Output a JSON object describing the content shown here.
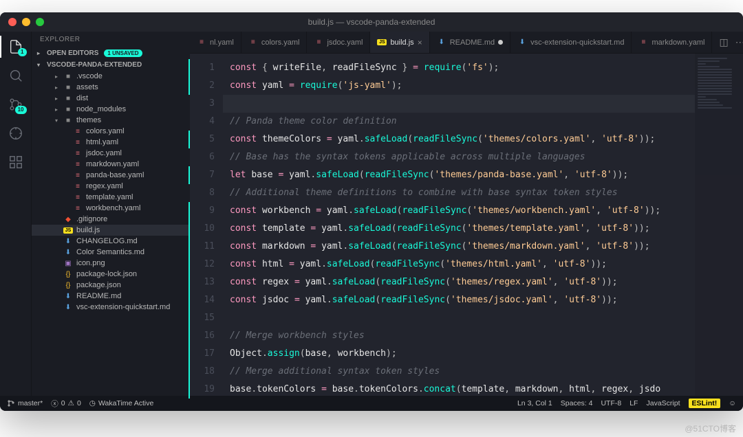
{
  "window": {
    "title": "build.js — vscode-panda-extended"
  },
  "activity": {
    "explorer_badge": "1",
    "scm_badge": "10"
  },
  "sidebar": {
    "title": "EXPLORER",
    "open_editors": {
      "label": "OPEN EDITORS",
      "unsaved": "1 UNSAVED"
    },
    "project": {
      "label": "VSCODE-PANDA-EXTENDED"
    },
    "tree": [
      {
        "depth": 1,
        "chev": "▸",
        "icon": "folder",
        "label": ".vscode"
      },
      {
        "depth": 1,
        "chev": "▸",
        "icon": "folder",
        "label": "assets"
      },
      {
        "depth": 1,
        "chev": "▸",
        "icon": "folder",
        "label": "dist"
      },
      {
        "depth": 1,
        "chev": "▸",
        "icon": "folder",
        "label": "node_modules"
      },
      {
        "depth": 1,
        "chev": "▾",
        "icon": "folder",
        "label": "themes"
      },
      {
        "depth": 2,
        "icon": "yaml",
        "label": "colors.yaml"
      },
      {
        "depth": 2,
        "icon": "yaml",
        "label": "html.yaml"
      },
      {
        "depth": 2,
        "icon": "yaml",
        "label": "jsdoc.yaml"
      },
      {
        "depth": 2,
        "icon": "yaml",
        "label": "markdown.yaml"
      },
      {
        "depth": 2,
        "icon": "yaml",
        "label": "panda-base.yaml"
      },
      {
        "depth": 2,
        "icon": "yaml",
        "label": "regex.yaml"
      },
      {
        "depth": 2,
        "icon": "yaml",
        "label": "template.yaml"
      },
      {
        "depth": 2,
        "icon": "yaml",
        "label": "workbench.yaml"
      },
      {
        "depth": 1,
        "icon": "git",
        "label": ".gitignore"
      },
      {
        "depth": 1,
        "icon": "js",
        "label": "build.js",
        "sel": true
      },
      {
        "depth": 1,
        "icon": "md",
        "label": "CHANGELOG.md"
      },
      {
        "depth": 1,
        "icon": "md",
        "label": "Color Semantics.md"
      },
      {
        "depth": 1,
        "icon": "img",
        "label": "icon.png"
      },
      {
        "depth": 1,
        "icon": "json",
        "label": "package-lock.json"
      },
      {
        "depth": 1,
        "icon": "json",
        "label": "package.json"
      },
      {
        "depth": 1,
        "icon": "md",
        "label": "README.md"
      },
      {
        "depth": 1,
        "icon": "md",
        "label": "vsc-extension-quickstart.md"
      }
    ]
  },
  "tabs": [
    {
      "icon": "yaml",
      "label": "nl.yaml"
    },
    {
      "icon": "yaml",
      "label": "colors.yaml"
    },
    {
      "icon": "yaml",
      "label": "jsdoc.yaml"
    },
    {
      "icon": "js",
      "label": "build.js",
      "active": true,
      "dirty": true
    },
    {
      "icon": "md",
      "label": "README.md",
      "dirty": true
    },
    {
      "icon": "md",
      "label": "vsc-extension-quickstart.md"
    },
    {
      "icon": "yaml",
      "label": "markdown.yaml"
    }
  ],
  "code": {
    "lines": [
      {
        "n": 1,
        "mod": true,
        "seg": [
          [
            "kw",
            "const"
          ],
          [
            "pn",
            " { "
          ],
          [
            "id",
            "writeFile"
          ],
          [
            "pn",
            ", "
          ],
          [
            "id",
            "readFileSync"
          ],
          [
            "pn",
            " } "
          ],
          [
            "op",
            "="
          ],
          [
            "pn",
            " "
          ],
          [
            "fn",
            "require"
          ],
          [
            "pn",
            "("
          ],
          [
            "str",
            "'fs'"
          ],
          [
            "pn",
            ");"
          ]
        ]
      },
      {
        "n": 2,
        "mod": true,
        "seg": [
          [
            "kw",
            "const"
          ],
          [
            "pn",
            " "
          ],
          [
            "id",
            "yaml"
          ],
          [
            "pn",
            " "
          ],
          [
            "op",
            "="
          ],
          [
            "pn",
            " "
          ],
          [
            "fn",
            "require"
          ],
          [
            "pn",
            "("
          ],
          [
            "str",
            "'js-yaml'"
          ],
          [
            "pn",
            ");"
          ]
        ]
      },
      {
        "n": 3,
        "mod": false,
        "cur": true,
        "seg": []
      },
      {
        "n": 4,
        "mod": false,
        "seg": [
          [
            "cm",
            "// Panda theme color definition"
          ]
        ]
      },
      {
        "n": 5,
        "mod": true,
        "seg": [
          [
            "kw",
            "const"
          ],
          [
            "pn",
            " "
          ],
          [
            "id",
            "themeColors"
          ],
          [
            "pn",
            " "
          ],
          [
            "op",
            "="
          ],
          [
            "pn",
            " "
          ],
          [
            "id",
            "yaml"
          ],
          [
            "pn",
            "."
          ],
          [
            "fn",
            "safeLoad"
          ],
          [
            "pn",
            "("
          ],
          [
            "fn",
            "readFileSync"
          ],
          [
            "pn",
            "("
          ],
          [
            "str",
            "'themes/colors.yaml'"
          ],
          [
            "pn",
            ", "
          ],
          [
            "str",
            "'utf-8'"
          ],
          [
            "pn",
            "));"
          ]
        ]
      },
      {
        "n": 6,
        "mod": false,
        "seg": [
          [
            "cm",
            "// Base has the syntax tokens applicable across multiple languages"
          ]
        ]
      },
      {
        "n": 7,
        "mod": true,
        "seg": [
          [
            "kw",
            "let"
          ],
          [
            "pn",
            " "
          ],
          [
            "id",
            "base"
          ],
          [
            "pn",
            " "
          ],
          [
            "op",
            "="
          ],
          [
            "pn",
            " "
          ],
          [
            "id",
            "yaml"
          ],
          [
            "pn",
            "."
          ],
          [
            "fn",
            "safeLoad"
          ],
          [
            "pn",
            "("
          ],
          [
            "fn",
            "readFileSync"
          ],
          [
            "pn",
            "("
          ],
          [
            "str",
            "'themes/panda-base.yaml'"
          ],
          [
            "pn",
            ", "
          ],
          [
            "str",
            "'utf-8'"
          ],
          [
            "pn",
            "));"
          ]
        ]
      },
      {
        "n": 8,
        "mod": false,
        "seg": [
          [
            "cm",
            "// Additional theme definitions to combine with base syntax token styles"
          ]
        ]
      },
      {
        "n": 9,
        "mod": true,
        "seg": [
          [
            "kw",
            "const"
          ],
          [
            "pn",
            " "
          ],
          [
            "id",
            "workbench"
          ],
          [
            "pn",
            " "
          ],
          [
            "op",
            "="
          ],
          [
            "pn",
            " "
          ],
          [
            "id",
            "yaml"
          ],
          [
            "pn",
            "."
          ],
          [
            "fn",
            "safeLoad"
          ],
          [
            "pn",
            "("
          ],
          [
            "fn",
            "readFileSync"
          ],
          [
            "pn",
            "("
          ],
          [
            "str",
            "'themes/workbench.yaml'"
          ],
          [
            "pn",
            ", "
          ],
          [
            "str",
            "'utf-8'"
          ],
          [
            "pn",
            "));"
          ]
        ]
      },
      {
        "n": 10,
        "mod": true,
        "seg": [
          [
            "kw",
            "const"
          ],
          [
            "pn",
            " "
          ],
          [
            "id",
            "template"
          ],
          [
            "pn",
            " "
          ],
          [
            "op",
            "="
          ],
          [
            "pn",
            " "
          ],
          [
            "id",
            "yaml"
          ],
          [
            "pn",
            "."
          ],
          [
            "fn",
            "safeLoad"
          ],
          [
            "pn",
            "("
          ],
          [
            "fn",
            "readFileSync"
          ],
          [
            "pn",
            "("
          ],
          [
            "str",
            "'themes/template.yaml'"
          ],
          [
            "pn",
            ", "
          ],
          [
            "str",
            "'utf-8'"
          ],
          [
            "pn",
            "));"
          ]
        ]
      },
      {
        "n": 11,
        "mod": true,
        "seg": [
          [
            "kw",
            "const"
          ],
          [
            "pn",
            " "
          ],
          [
            "id",
            "markdown"
          ],
          [
            "pn",
            " "
          ],
          [
            "op",
            "="
          ],
          [
            "pn",
            " "
          ],
          [
            "id",
            "yaml"
          ],
          [
            "pn",
            "."
          ],
          [
            "fn",
            "safeLoad"
          ],
          [
            "pn",
            "("
          ],
          [
            "fn",
            "readFileSync"
          ],
          [
            "pn",
            "("
          ],
          [
            "str",
            "'themes/markdown.yaml'"
          ],
          [
            "pn",
            ", "
          ],
          [
            "str",
            "'utf-8'"
          ],
          [
            "pn",
            "));"
          ]
        ]
      },
      {
        "n": 12,
        "mod": true,
        "seg": [
          [
            "kw",
            "const"
          ],
          [
            "pn",
            " "
          ],
          [
            "id",
            "html"
          ],
          [
            "pn",
            " "
          ],
          [
            "op",
            "="
          ],
          [
            "pn",
            " "
          ],
          [
            "id",
            "yaml"
          ],
          [
            "pn",
            "."
          ],
          [
            "fn",
            "safeLoad"
          ],
          [
            "pn",
            "("
          ],
          [
            "fn",
            "readFileSync"
          ],
          [
            "pn",
            "("
          ],
          [
            "str",
            "'themes/html.yaml'"
          ],
          [
            "pn",
            ", "
          ],
          [
            "str",
            "'utf-8'"
          ],
          [
            "pn",
            "));"
          ]
        ]
      },
      {
        "n": 13,
        "mod": true,
        "seg": [
          [
            "kw",
            "const"
          ],
          [
            "pn",
            " "
          ],
          [
            "id",
            "regex"
          ],
          [
            "pn",
            " "
          ],
          [
            "op",
            "="
          ],
          [
            "pn",
            " "
          ],
          [
            "id",
            "yaml"
          ],
          [
            "pn",
            "."
          ],
          [
            "fn",
            "safeLoad"
          ],
          [
            "pn",
            "("
          ],
          [
            "fn",
            "readFileSync"
          ],
          [
            "pn",
            "("
          ],
          [
            "str",
            "'themes/regex.yaml'"
          ],
          [
            "pn",
            ", "
          ],
          [
            "str",
            "'utf-8'"
          ],
          [
            "pn",
            "));"
          ]
        ]
      },
      {
        "n": 14,
        "mod": true,
        "seg": [
          [
            "kw",
            "const"
          ],
          [
            "pn",
            " "
          ],
          [
            "id",
            "jsdoc"
          ],
          [
            "pn",
            " "
          ],
          [
            "op",
            "="
          ],
          [
            "pn",
            " "
          ],
          [
            "id",
            "yaml"
          ],
          [
            "pn",
            "."
          ],
          [
            "fn",
            "safeLoad"
          ],
          [
            "pn",
            "("
          ],
          [
            "fn",
            "readFileSync"
          ],
          [
            "pn",
            "("
          ],
          [
            "str",
            "'themes/jsdoc.yaml'"
          ],
          [
            "pn",
            ", "
          ],
          [
            "str",
            "'utf-8'"
          ],
          [
            "pn",
            "));"
          ]
        ]
      },
      {
        "n": 15,
        "mod": true,
        "seg": []
      },
      {
        "n": 16,
        "mod": true,
        "seg": [
          [
            "cm",
            "// Merge workbench styles"
          ]
        ]
      },
      {
        "n": 17,
        "mod": true,
        "seg": [
          [
            "id",
            "Object"
          ],
          [
            "pn",
            "."
          ],
          [
            "fn",
            "assign"
          ],
          [
            "pn",
            "("
          ],
          [
            "id",
            "base"
          ],
          [
            "pn",
            ", "
          ],
          [
            "id",
            "workbench"
          ],
          [
            "pn",
            ");"
          ]
        ]
      },
      {
        "n": 18,
        "mod": true,
        "seg": [
          [
            "cm",
            "// Merge additional syntax token styles"
          ]
        ]
      },
      {
        "n": 19,
        "mod": true,
        "seg": [
          [
            "id",
            "base"
          ],
          [
            "pn",
            "."
          ],
          [
            "id",
            "tokenColors"
          ],
          [
            "pn",
            " "
          ],
          [
            "op",
            "="
          ],
          [
            "pn",
            " "
          ],
          [
            "id",
            "base"
          ],
          [
            "pn",
            "."
          ],
          [
            "id",
            "tokenColors"
          ],
          [
            "pn",
            "."
          ],
          [
            "fn",
            "concat"
          ],
          [
            "pn",
            "("
          ],
          [
            "id",
            "template"
          ],
          [
            "pn",
            ", "
          ],
          [
            "id",
            "markdown"
          ],
          [
            "pn",
            ", "
          ],
          [
            "id",
            "html"
          ],
          [
            "pn",
            ", "
          ],
          [
            "id",
            "regex"
          ],
          [
            "pn",
            ", "
          ],
          [
            "id",
            "jsdo"
          ]
        ]
      }
    ]
  },
  "statusbar": {
    "branch": "master*",
    "errors": "0",
    "warnings": "0",
    "waka": "WakaTime Active",
    "cursor": "Ln 3, Col 1",
    "spaces": "Spaces: 4",
    "encoding": "UTF-8",
    "eol": "LF",
    "lang": "JavaScript",
    "eslint": "ESLint!"
  },
  "watermark": "@51CTO博客"
}
